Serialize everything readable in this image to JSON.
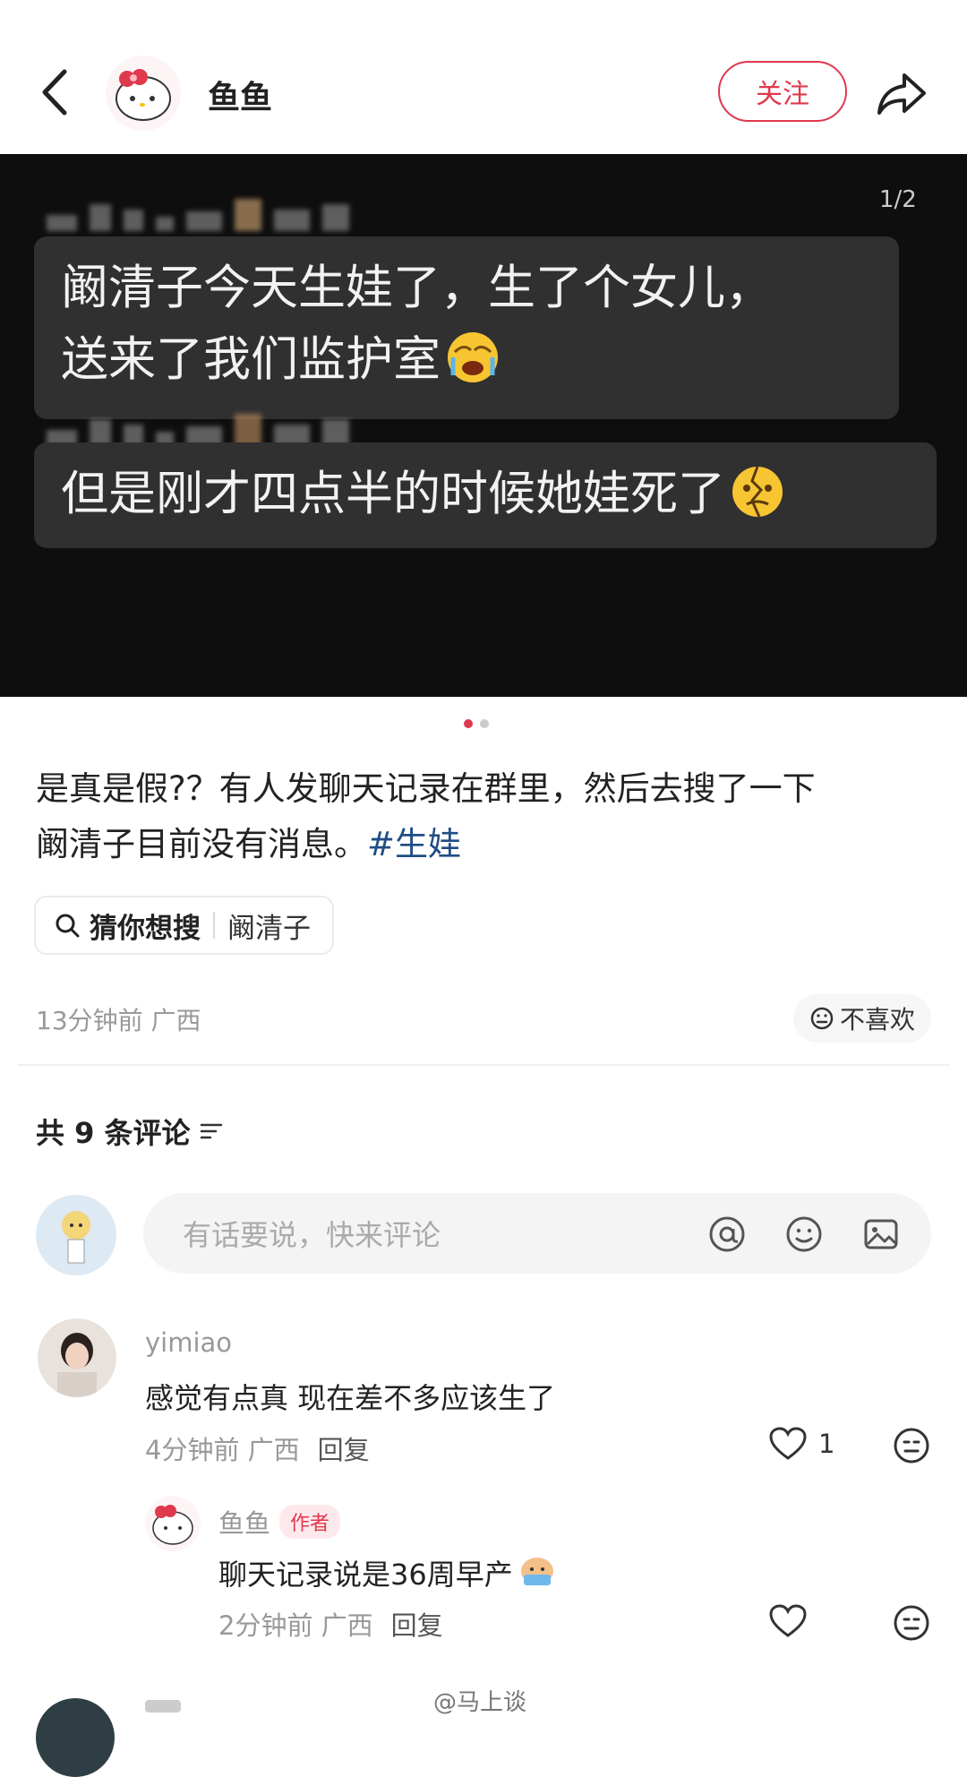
{
  "header": {
    "author_name": "鱼鱼",
    "follow_label": "关注"
  },
  "image": {
    "page_indicator": "1/2",
    "messages": [
      {
        "line1": "阚清子今天生娃了，生了个女儿，",
        "line2": "送来了我们监护室",
        "emoji": "crying-face-emoji"
      },
      {
        "line1": "但是刚才四点半的时候她娃死了",
        "emoji": "broken-face-emoji"
      }
    ]
  },
  "carousel": {
    "current": 1,
    "total": 2,
    "active_color": "#e0384d",
    "inactive_color": "#cccccc"
  },
  "post": {
    "text_line1": "是真是假?？有人发聊天记录在群里，然后去搜了一下",
    "text_line2": "阚清子目前没有消息。",
    "tag": "#生娃",
    "suggest_label": "猜你想搜",
    "suggest_term": "阚清子",
    "meta": "13分钟前  广西",
    "dislike_label": "不喜欢"
  },
  "comments_section": {
    "header": "共 9 条评论",
    "input_placeholder": "有话要说，快来评论",
    "input_icons": [
      "at-icon",
      "emoji-icon",
      "image-icon"
    ]
  },
  "comments": [
    {
      "name": "yimiao",
      "text": "感觉有点真 现在差不多应该生了",
      "meta": "4分钟前  广西",
      "reply_label": "回复",
      "likes": "1"
    },
    {
      "name": "鱼鱼",
      "badge": "作者",
      "text": "聊天记录说是36周早产",
      "meta": "2分钟前  广西",
      "reply_label": "回复"
    }
  ],
  "watermark": "@马上谈",
  "colors": {
    "accent": "#e0384d",
    "tag": "#1f4d85",
    "bubble": "#303030",
    "panel": "#0e0e0e"
  }
}
